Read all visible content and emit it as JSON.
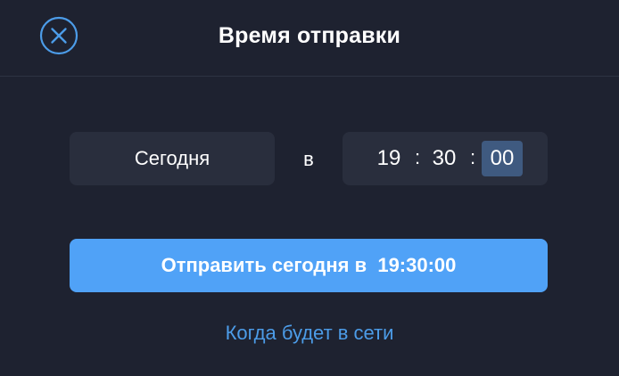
{
  "header": {
    "title": "Время отправки",
    "close_icon": "close-circle-icon"
  },
  "schedule": {
    "day": "Сегодня",
    "at_label": "в",
    "time": {
      "hours": "19",
      "minutes": "30",
      "seconds": "00",
      "separator": ":"
    }
  },
  "actions": {
    "send_label": "Отправить сегодня в  19:30:00",
    "online_link": "Когда будет в сети"
  },
  "colors": {
    "background": "#1e2230",
    "field_background": "#292e3d",
    "accent": "#50a2f7",
    "link": "#4c9ce8",
    "selection": "#3f5a80"
  }
}
